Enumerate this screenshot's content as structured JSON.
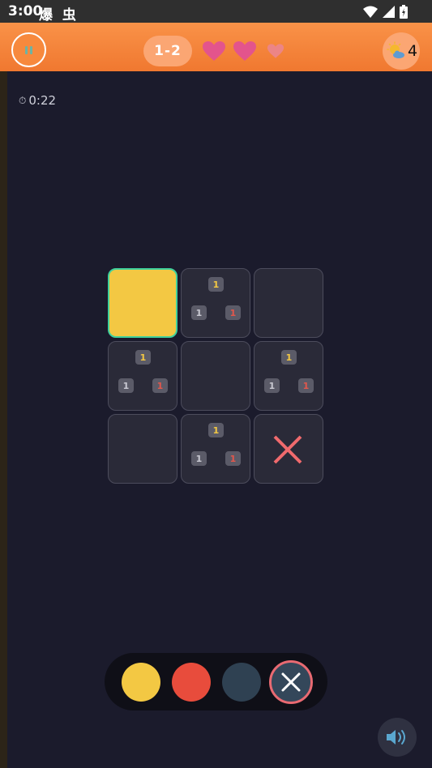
{
  "status_bar": {
    "time": "3:00",
    "app_glyphs": "爆 虫"
  },
  "header": {
    "level": "1-2",
    "lives": {
      "total": 3,
      "remaining": 2
    },
    "hint_count": "4"
  },
  "timer": {
    "icon": "⏱",
    "value": "0:22"
  },
  "board": {
    "rows": 3,
    "cols": 3,
    "cells": [
      {
        "state": "yellow"
      },
      {
        "state": "empty",
        "clues": {
          "top": "1",
          "bottom_left": "1",
          "bottom_right": "1"
        }
      },
      {
        "state": "empty"
      },
      {
        "state": "empty",
        "clues": {
          "top": "1",
          "bottom_left": "1",
          "bottom_right": "1"
        }
      },
      {
        "state": "empty"
      },
      {
        "state": "empty",
        "clues": {
          "top": "1",
          "bottom_left": "1",
          "bottom_right": "1"
        }
      },
      {
        "state": "empty"
      },
      {
        "state": "empty",
        "clues": {
          "top": "1",
          "bottom_left": "1",
          "bottom_right": "1"
        }
      },
      {
        "state": "crossed"
      }
    ]
  },
  "palette": {
    "options": [
      {
        "name": "yellow",
        "color": "#f3c843"
      },
      {
        "name": "red",
        "color": "#e84c3c"
      },
      {
        "name": "navy",
        "color": "#2f4152"
      },
      {
        "name": "eraser",
        "selected": true
      }
    ]
  },
  "colors": {
    "header": "#f7893d",
    "background": "#1b1b2c",
    "heart_full": "#e3548c",
    "heart_empty": "#ec8585",
    "cross": "#f06a6d"
  }
}
